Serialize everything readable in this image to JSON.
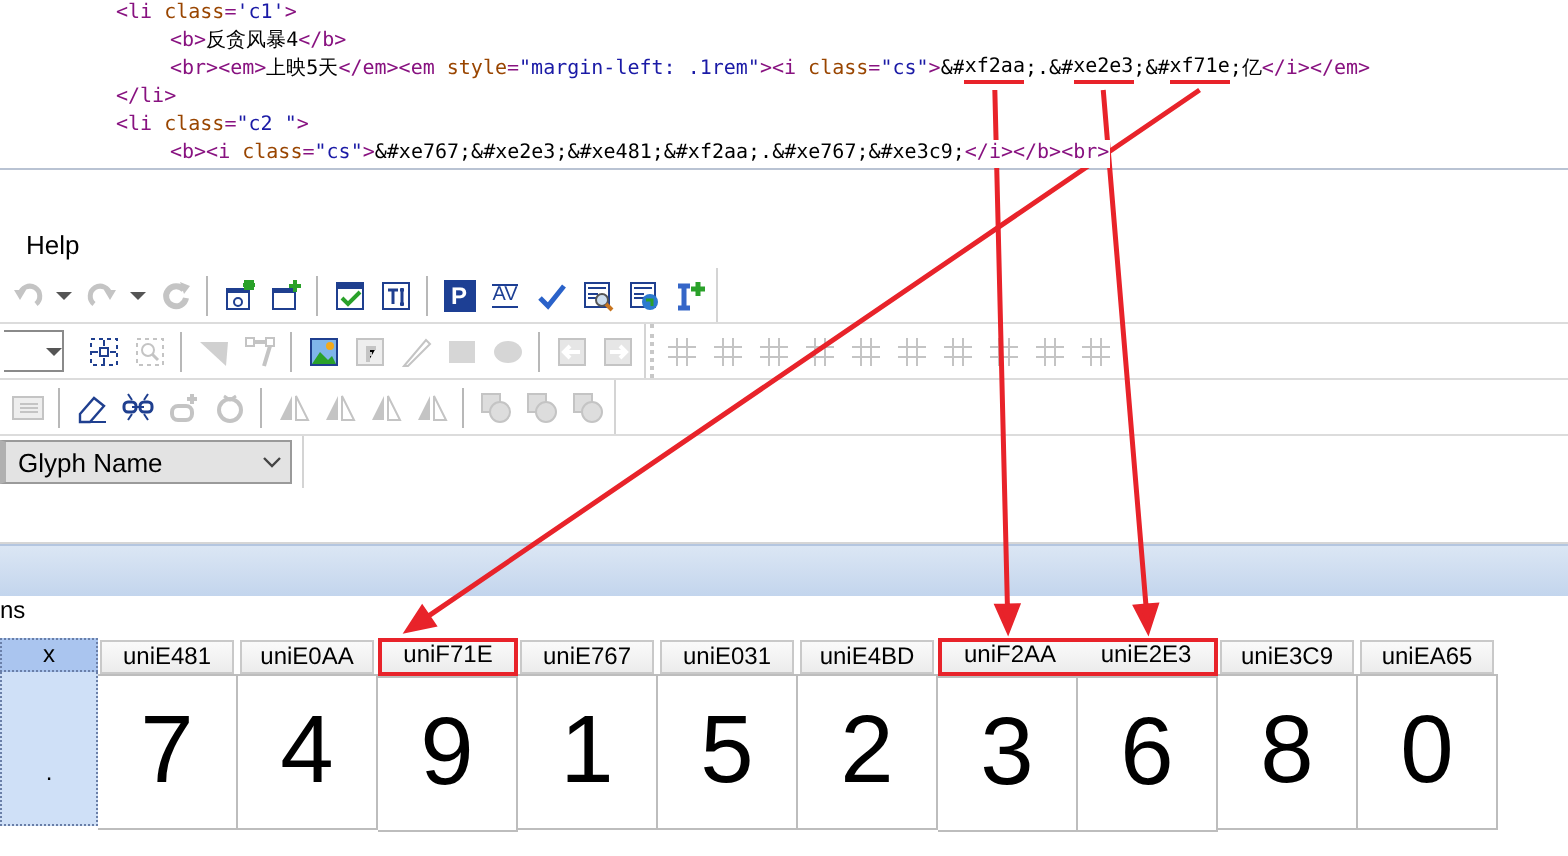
{
  "code": {
    "lines": [
      {
        "indented": false,
        "tokens": [
          {
            "kind": "tag",
            "text": "<li ",
            "underlined": false
          },
          {
            "kind": "attr",
            "text": "class",
            "underlined": false
          },
          {
            "kind": "tag",
            "text": "=",
            "underlined": false
          },
          {
            "kind": "value",
            "text": "'c1'",
            "underlined": false
          },
          {
            "kind": "tag",
            "text": ">",
            "underlined": false
          }
        ]
      },
      {
        "indented": true,
        "tokens": [
          {
            "kind": "tag",
            "text": "<b>",
            "underlined": false
          },
          {
            "kind": "text",
            "text": "反贪风暴4",
            "underlined": false
          },
          {
            "kind": "tag",
            "text": "</b>",
            "underlined": false
          }
        ]
      },
      {
        "indented": true,
        "tokens": [
          {
            "kind": "tag",
            "text": "<br><em>",
            "underlined": false
          },
          {
            "kind": "text",
            "text": "上映5天",
            "underlined": false
          },
          {
            "kind": "tag",
            "text": "</em><em ",
            "underlined": false
          },
          {
            "kind": "attr",
            "text": "style",
            "underlined": false
          },
          {
            "kind": "tag",
            "text": "=",
            "underlined": false
          },
          {
            "kind": "value",
            "text": "\"margin-left: .1rem\"",
            "underlined": false
          },
          {
            "kind": "tag",
            "text": "><i ",
            "underlined": false
          },
          {
            "kind": "attr",
            "text": "class",
            "underlined": false
          },
          {
            "kind": "tag",
            "text": "=",
            "underlined": false
          },
          {
            "kind": "value",
            "text": "\"cs\"",
            "underlined": false
          },
          {
            "kind": "tag",
            "text": ">",
            "underlined": false
          },
          {
            "kind": "text",
            "text": "&#",
            "underlined": false
          },
          {
            "kind": "text",
            "text": "xf2aa",
            "underlined": true
          },
          {
            "kind": "text",
            "text": ";.&#",
            "underlined": false
          },
          {
            "kind": "text",
            "text": "xe2e3",
            "underlined": true
          },
          {
            "kind": "text",
            "text": ";&#",
            "underlined": false
          },
          {
            "kind": "text",
            "text": "xf71e",
            "underlined": true
          },
          {
            "kind": "text",
            "text": ";亿",
            "underlined": false
          },
          {
            "kind": "tag",
            "text": "</i></em>",
            "underlined": false
          }
        ]
      },
      {
        "indented": false,
        "tokens": [
          {
            "kind": "tag",
            "text": "</li>",
            "underlined": false
          }
        ]
      },
      {
        "indented": false,
        "tokens": [
          {
            "kind": "tag",
            "text": "<li ",
            "underlined": false
          },
          {
            "kind": "attr",
            "text": "class",
            "underlined": false
          },
          {
            "kind": "tag",
            "text": "=",
            "underlined": false
          },
          {
            "kind": "value",
            "text": "\"c2 \"",
            "underlined": false
          },
          {
            "kind": "tag",
            "text": ">",
            "underlined": false
          }
        ]
      },
      {
        "indented": true,
        "tokens": [
          {
            "kind": "tag",
            "text": "<b><i ",
            "underlined": false
          },
          {
            "kind": "attr",
            "text": "class",
            "underlined": false
          },
          {
            "kind": "tag",
            "text": "=",
            "underlined": false
          },
          {
            "kind": "value",
            "text": "\"cs\"",
            "underlined": false
          },
          {
            "kind": "tag",
            "text": ">",
            "underlined": false
          },
          {
            "kind": "text",
            "text": "&#xe767;&#xe2e3;&#xe481;&#xf2aa;.&#xe767;&#xe3c9;",
            "underlined": false
          },
          {
            "kind": "tag",
            "text": "</i></b><br>",
            "underlined": false
          }
        ]
      }
    ]
  },
  "menu": [
    {
      "label": "Help"
    }
  ],
  "toolbar_rows": [
    [
      {
        "items": [
          {
            "kind": "undo",
            "disabled": true
          },
          {
            "kind": "caret",
            "disabled": false
          },
          {
            "kind": "redo",
            "disabled": true
          },
          {
            "kind": "caret",
            "disabled": false
          },
          {
            "kind": "refresh",
            "disabled": true
          },
          {
            "kind": "separator"
          },
          {
            "kind": "new-glyph",
            "disabled": false
          },
          {
            "kind": "add-glyph",
            "disabled": false
          },
          {
            "kind": "separator"
          },
          {
            "kind": "validate",
            "disabled": false
          },
          {
            "kind": "text-size",
            "disabled": false
          },
          {
            "kind": "separator"
          },
          {
            "kind": "letter",
            "label": "P",
            "disabled": false
          },
          {
            "kind": "kerning",
            "label": "AV",
            "disabled": false
          },
          {
            "kind": "check",
            "disabled": false
          },
          {
            "kind": "doc-search",
            "disabled": false
          },
          {
            "kind": "doc-globe",
            "disabled": false
          },
          {
            "kind": "cursor-plus",
            "disabled": false
          }
        ]
      }
    ],
    [
      {
        "items": [
          {
            "kind": "dropdown",
            "disabled": false
          },
          {
            "kind": "select-frame",
            "disabled": false
          },
          {
            "kind": "zoom-rect",
            "disabled": true
          },
          {
            "kind": "separator"
          },
          {
            "kind": "triangle",
            "disabled": true
          },
          {
            "kind": "nodes",
            "disabled": true
          },
          {
            "kind": "separator"
          },
          {
            "kind": "image",
            "disabled": false
          },
          {
            "kind": "f-image",
            "disabled": true
          },
          {
            "kind": "pencil",
            "disabled": true
          },
          {
            "kind": "square",
            "disabled": true
          },
          {
            "kind": "circle",
            "disabled": true
          },
          {
            "kind": "separator"
          },
          {
            "kind": "arrow-left",
            "disabled": true
          },
          {
            "kind": "arrow-right",
            "disabled": true
          }
        ]
      },
      {
        "items": [
          {
            "kind": "grid",
            "disabled": true
          },
          {
            "kind": "grid",
            "disabled": true
          },
          {
            "kind": "grid",
            "disabled": true
          },
          {
            "kind": "grid",
            "disabled": true
          },
          {
            "kind": "grid",
            "disabled": true
          },
          {
            "kind": "grid",
            "disabled": true
          },
          {
            "kind": "grid",
            "disabled": true
          },
          {
            "kind": "grid",
            "disabled": true
          },
          {
            "kind": "grid",
            "disabled": true
          },
          {
            "kind": "grid",
            "disabled": true
          }
        ]
      }
    ],
    [
      {
        "items": [
          {
            "kind": "list",
            "disabled": true
          },
          {
            "kind": "separator"
          },
          {
            "kind": "eraser",
            "disabled": false
          },
          {
            "kind": "link",
            "disabled": false
          },
          {
            "kind": "shape-add",
            "disabled": true
          },
          {
            "kind": "rotate",
            "disabled": true
          },
          {
            "kind": "separator"
          },
          {
            "kind": "flip",
            "disabled": true
          },
          {
            "kind": "flip",
            "disabled": true
          },
          {
            "kind": "flip",
            "disabled": true
          },
          {
            "kind": "flip",
            "disabled": true
          },
          {
            "kind": "separator"
          },
          {
            "kind": "overlap",
            "disabled": true
          },
          {
            "kind": "overlap",
            "disabled": true
          },
          {
            "kind": "overlap",
            "disabled": true
          }
        ]
      }
    ]
  ],
  "view_select": {
    "value": "Glyph Name"
  },
  "glyph_panel": {
    "label": "ns",
    "columns": [
      {
        "name": "x",
        "glyph": ".",
        "selected": true,
        "highlighted": false
      },
      {
        "name": "uniE481",
        "glyph": "7",
        "selected": false,
        "highlighted": false
      },
      {
        "name": "uniE0AA",
        "glyph": "4",
        "selected": false,
        "highlighted": false
      },
      {
        "name": "uniF71E",
        "glyph": "9",
        "selected": false,
        "highlighted": true
      },
      {
        "name": "uniE767",
        "glyph": "1",
        "selected": false,
        "highlighted": false
      },
      {
        "name": "uniE031",
        "glyph": "5",
        "selected": false,
        "highlighted": false
      },
      {
        "name": "uniE4BD",
        "glyph": "2",
        "selected": false,
        "highlighted": false
      },
      {
        "name": "uniF2AA",
        "glyph": "3",
        "selected": false,
        "highlighted": true
      },
      {
        "name": "uniE2E3",
        "glyph": "6",
        "selected": false,
        "highlighted": true
      },
      {
        "name": "uniE3C9",
        "glyph": "8",
        "selected": false,
        "highlighted": false
      },
      {
        "name": "uniEA65",
        "glyph": "0",
        "selected": false,
        "highlighted": false
      }
    ]
  }
}
